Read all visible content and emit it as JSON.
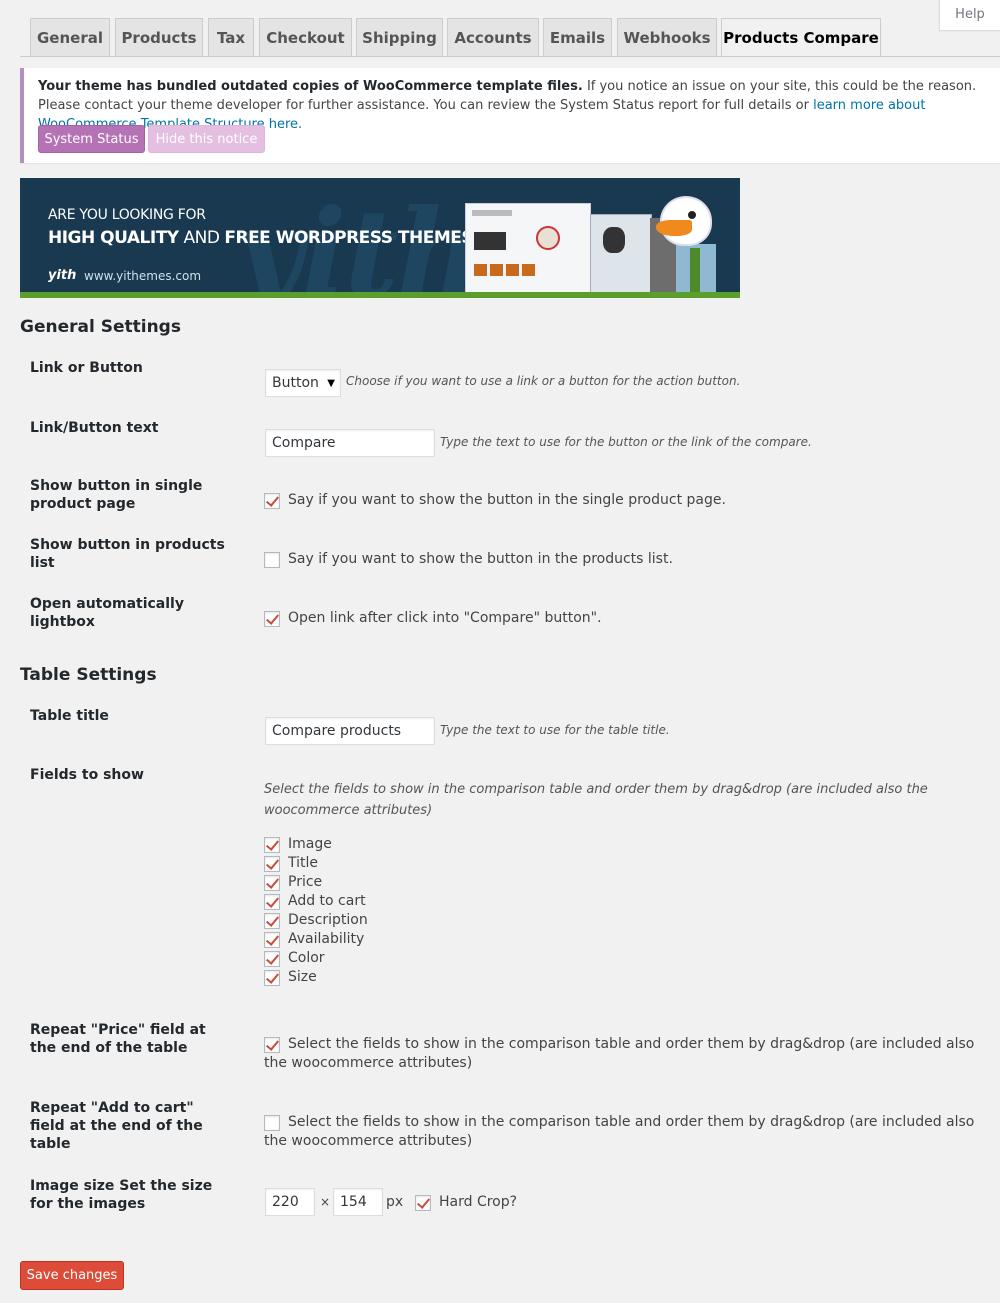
{
  "help": {
    "label": "Help"
  },
  "tabs": [
    {
      "label": "General",
      "active": false
    },
    {
      "label": "Products",
      "active": false
    },
    {
      "label": "Tax",
      "active": false
    },
    {
      "label": "Checkout",
      "active": false
    },
    {
      "label": "Shipping",
      "active": false
    },
    {
      "label": "Accounts",
      "active": false
    },
    {
      "label": "Emails",
      "active": false
    },
    {
      "label": "Webhooks",
      "active": false
    },
    {
      "label": "Products Compare",
      "active": true
    }
  ],
  "notice": {
    "bold_text": "Your theme has bundled outdated copies of WooCommerce template files.",
    "text": " If you notice an issue on your site, this could be the reason. Please contact your theme developer for further assistance. You can review the System Status report for full details or ",
    "link_text": "learn more about WooCommerce Template Structure here.",
    "system_status_label": "System Status",
    "hide_label": "Hide this notice",
    "accent_color": "#b572b5"
  },
  "banner": {
    "line1": "ARE YOU LOOKING FOR",
    "line2_bold1": "HIGH QUALITY",
    "line2_mid": " AND ",
    "line2_bold2": "FREE WORDPRESS THEMES?",
    "logo": "yith",
    "url": "www.yithemes.com",
    "bg_word": "yith"
  },
  "general": {
    "heading": "General Settings",
    "link_or_button": {
      "label": "Link or Button",
      "value": "Button",
      "desc": "Choose if you want to use a link or a button for the action button."
    },
    "button_text": {
      "label": "Link/Button text",
      "value": "Compare",
      "desc": "Type the text to use for the button or the link of the compare."
    },
    "show_single": {
      "label": "Show button in single product page",
      "checked": true,
      "text": "Say if you want to show the button in the single product page."
    },
    "show_list": {
      "label": "Show button in products list",
      "checked": false,
      "text": "Say if you want to show the button in the products list."
    },
    "lightbox": {
      "label": "Open automatically lightbox",
      "checked": true,
      "text": "Open link after click into \"Compare\" button\"."
    }
  },
  "table": {
    "heading": "Table Settings",
    "title": {
      "label": "Table title",
      "value": "Compare products",
      "desc": "Type the text to use for the table title."
    },
    "fields": {
      "label": "Fields to show",
      "desc": "Select the fields to show in the comparison table and order them by drag&drop (are included also the woocommerce attributes)",
      "items": [
        {
          "label": "Image",
          "checked": true
        },
        {
          "label": "Title",
          "checked": true
        },
        {
          "label": "Price",
          "checked": true
        },
        {
          "label": "Add to cart",
          "checked": true
        },
        {
          "label": "Description",
          "checked": true
        },
        {
          "label": "Availability",
          "checked": true
        },
        {
          "label": "Color",
          "checked": true
        },
        {
          "label": "Size",
          "checked": true
        }
      ]
    },
    "repeat_price": {
      "label": "Repeat \"Price\" field at the end of the table",
      "checked": true,
      "text": "Select the fields to show in the comparison table and order them by drag&drop (are included also the woocommerce attributes)"
    },
    "repeat_cart": {
      "label": "Repeat \"Add to cart\" field at the end of the table",
      "checked": false,
      "text": "Select the fields to show in the comparison table and order them by drag&drop (are included also the woocommerce attributes)"
    },
    "image_size": {
      "label": "Image size Set the size for the images",
      "width": "220",
      "times": "×",
      "height": "154",
      "unit": "px",
      "hard_crop_checked": true,
      "hard_crop_label": "Hard Crop?"
    }
  },
  "save": {
    "label": "Save changes",
    "color": "#dd4b39"
  }
}
